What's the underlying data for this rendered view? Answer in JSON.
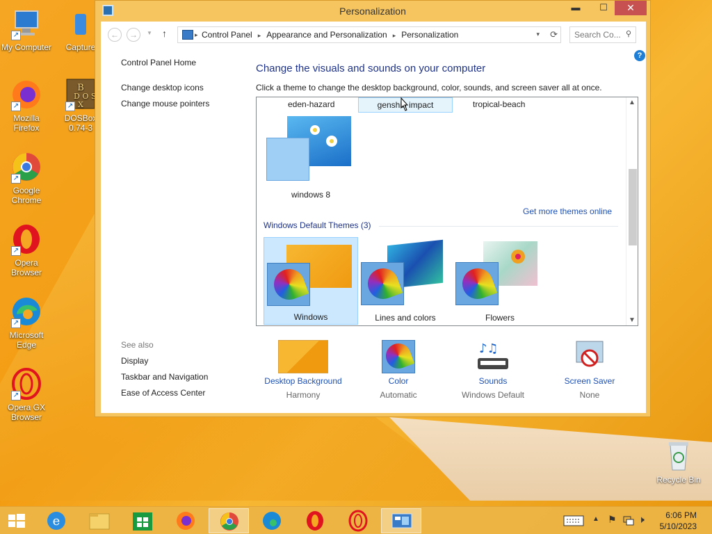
{
  "desktop": {
    "icons": [
      {
        "label": "My Computer"
      },
      {
        "label": "Capture"
      },
      {
        "label": "Mozilla Firefox"
      },
      {
        "label": "DOSBox 0.74-3"
      },
      {
        "label": "Google Chrome"
      },
      {
        "label": "Opera Browser"
      },
      {
        "label": "Microsoft Edge"
      },
      {
        "label": "Opera GX Browser"
      },
      {
        "label": "Recycle Bin"
      }
    ]
  },
  "window": {
    "title": "Personalization",
    "minimize": "▬",
    "maximize": "☐",
    "close": "✕"
  },
  "address": {
    "crumbs": [
      "Control Panel",
      "Appearance and Personalization",
      "Personalization"
    ],
    "search_placeholder": "Search Co..."
  },
  "left_pane": {
    "home": "Control Panel Home",
    "links": [
      "Change desktop icons",
      "Change mouse pointers"
    ],
    "see_also_title": "See also",
    "see_also": [
      "Display",
      "Taskbar and Navigation",
      "Ease of Access Center"
    ]
  },
  "main": {
    "heading": "Change the visuals and sounds on your computer",
    "subheading": "Click a theme to change the desktop background, color, sounds, and screen saver all at once.",
    "top_themes": [
      "eden-hazard",
      "genshin impact",
      "tropical-beach"
    ],
    "my_theme": "windows 8",
    "get_more": "Get more themes online",
    "default_group": "Windows Default Themes (3)",
    "default_themes": [
      "Windows",
      "Lines and colors",
      "Flowers"
    ]
  },
  "bottom": [
    {
      "title": "Desktop Background",
      "value": "Harmony"
    },
    {
      "title": "Color",
      "value": "Automatic"
    },
    {
      "title": "Sounds",
      "value": "Windows Default"
    },
    {
      "title": "Screen Saver",
      "value": "None"
    }
  ],
  "taskbar": {
    "time": "6:06 PM",
    "date": "5/10/2023"
  },
  "colors": {
    "accent_link": "#1e50b4",
    "heading": "#1e3287",
    "selection": "#cce8ff",
    "close_button": "#c75050"
  }
}
